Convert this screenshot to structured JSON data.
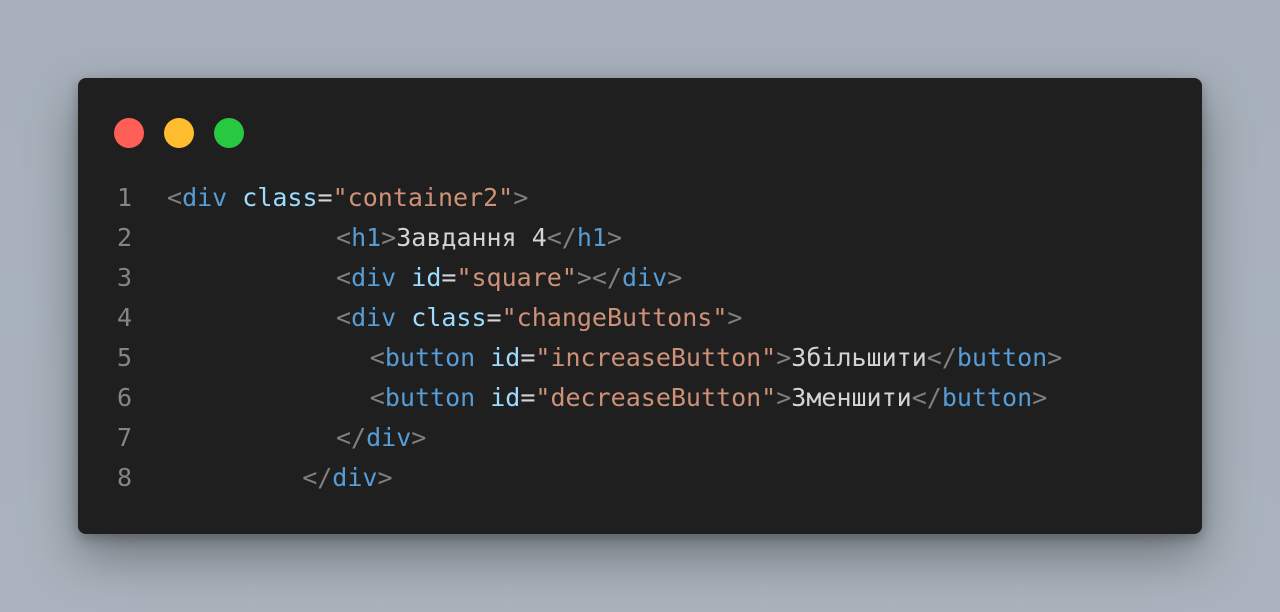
{
  "window": {
    "background": "#1f1f1f",
    "controls": [
      {
        "name": "close",
        "color": "#ff5f57"
      },
      {
        "name": "minimize",
        "color": "#febc2e"
      },
      {
        "name": "maximize",
        "color": "#28c840"
      }
    ]
  },
  "theme": {
    "punctuation": "#808080",
    "tag": "#569cd6",
    "attribute": "#9cdcfe",
    "string": "#ce9178",
    "text": "#d4d4d4",
    "line_number": "#858585"
  },
  "code_lines": [
    {
      "number": "1",
      "indent": 0,
      "tokens": [
        {
          "type": "punct",
          "text": "<"
        },
        {
          "type": "tag",
          "text": "div"
        },
        {
          "type": "space",
          "text": " "
        },
        {
          "type": "attr",
          "text": "class"
        },
        {
          "type": "eq",
          "text": "="
        },
        {
          "type": "str",
          "text": "\"container2\""
        },
        {
          "type": "punct",
          "text": ">"
        }
      ]
    },
    {
      "number": "2",
      "indent": 10,
      "tokens": [
        {
          "type": "punct",
          "text": "<"
        },
        {
          "type": "tag",
          "text": "h1"
        },
        {
          "type": "punct",
          "text": ">"
        },
        {
          "type": "text",
          "text": "Завдання 4"
        },
        {
          "type": "punct",
          "text": "</"
        },
        {
          "type": "tag",
          "text": "h1"
        },
        {
          "type": "punct",
          "text": ">"
        }
      ]
    },
    {
      "number": "3",
      "indent": 10,
      "tokens": [
        {
          "type": "punct",
          "text": "<"
        },
        {
          "type": "tag",
          "text": "div"
        },
        {
          "type": "space",
          "text": " "
        },
        {
          "type": "attr",
          "text": "id"
        },
        {
          "type": "eq",
          "text": "="
        },
        {
          "type": "str",
          "text": "\"square\""
        },
        {
          "type": "punct",
          "text": "></"
        },
        {
          "type": "tag",
          "text": "div"
        },
        {
          "type": "punct",
          "text": ">"
        }
      ]
    },
    {
      "number": "4",
      "indent": 10,
      "tokens": [
        {
          "type": "punct",
          "text": "<"
        },
        {
          "type": "tag",
          "text": "div"
        },
        {
          "type": "space",
          "text": " "
        },
        {
          "type": "attr",
          "text": "class"
        },
        {
          "type": "eq",
          "text": "="
        },
        {
          "type": "str",
          "text": "\"changeButtons\""
        },
        {
          "type": "punct",
          "text": ">"
        }
      ]
    },
    {
      "number": "5",
      "indent": 12,
      "tokens": [
        {
          "type": "punct",
          "text": "<"
        },
        {
          "type": "tag",
          "text": "button"
        },
        {
          "type": "space",
          "text": " "
        },
        {
          "type": "attr",
          "text": "id"
        },
        {
          "type": "eq",
          "text": "="
        },
        {
          "type": "str",
          "text": "\"increaseButton\""
        },
        {
          "type": "punct",
          "text": ">"
        },
        {
          "type": "text",
          "text": "Збільшити"
        },
        {
          "type": "punct",
          "text": "</"
        },
        {
          "type": "tag",
          "text": "button"
        },
        {
          "type": "punct",
          "text": ">"
        }
      ]
    },
    {
      "number": "6",
      "indent": 12,
      "tokens": [
        {
          "type": "punct",
          "text": "<"
        },
        {
          "type": "tag",
          "text": "button"
        },
        {
          "type": "space",
          "text": " "
        },
        {
          "type": "attr",
          "text": "id"
        },
        {
          "type": "eq",
          "text": "="
        },
        {
          "type": "str",
          "text": "\"decreaseButton\""
        },
        {
          "type": "punct",
          "text": ">"
        },
        {
          "type": "text",
          "text": "Зменшити"
        },
        {
          "type": "punct",
          "text": "</"
        },
        {
          "type": "tag",
          "text": "button"
        },
        {
          "type": "punct",
          "text": ">"
        }
      ]
    },
    {
      "number": "7",
      "indent": 10,
      "tokens": [
        {
          "type": "punct",
          "text": "</"
        },
        {
          "type": "tag",
          "text": "div"
        },
        {
          "type": "punct",
          "text": ">"
        }
      ]
    },
    {
      "number": "8",
      "indent": 8,
      "tokens": [
        {
          "type": "punct",
          "text": "</"
        },
        {
          "type": "tag",
          "text": "div"
        },
        {
          "type": "punct",
          "text": ">"
        }
      ]
    }
  ]
}
